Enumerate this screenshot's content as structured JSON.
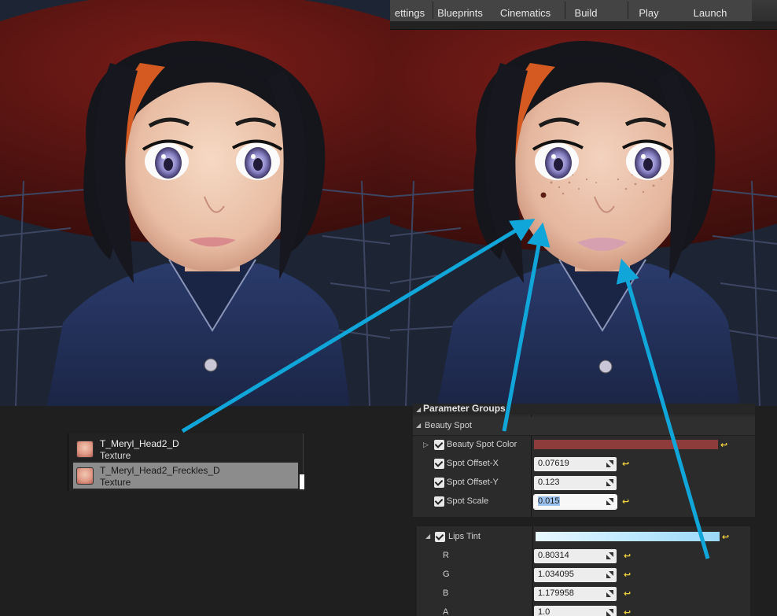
{
  "toolbar": {
    "buttons": [
      "ettings",
      "Blueprints",
      "Cinematics",
      "Build",
      "Play",
      "Launch"
    ]
  },
  "content_browser": {
    "items": [
      {
        "name": "T_Meryl_Head2_D",
        "type": "Texture",
        "selected": false
      },
      {
        "name": "T_Meryl_Head2_Freckles_D",
        "type": "Texture",
        "selected": true
      }
    ]
  },
  "details": {
    "header": "Parameter Groups",
    "group": "Beauty Spot",
    "beauty_spot_color": {
      "label": "Beauty Spot Color",
      "color": "#8e3b3b"
    },
    "params": [
      {
        "label": "Spot Offset-X",
        "value": "0.07619"
      },
      {
        "label": "Spot Offset-Y",
        "value": "0.123"
      },
      {
        "label": "Spot Scale",
        "value": "0.015"
      }
    ]
  },
  "lips": {
    "label": "Lips Tint",
    "color": "#bfe9ff",
    "channels": [
      {
        "label": "R",
        "value": "0.80314"
      },
      {
        "label": "G",
        "value": "1.034095"
      },
      {
        "label": "B",
        "value": "1.179958"
      },
      {
        "label": "A",
        "value": "1.0"
      }
    ]
  },
  "colors": {
    "arrow": "#11a6d9",
    "reset_icon": "#f2d13d",
    "panel_bg": "#2b2b2b"
  }
}
